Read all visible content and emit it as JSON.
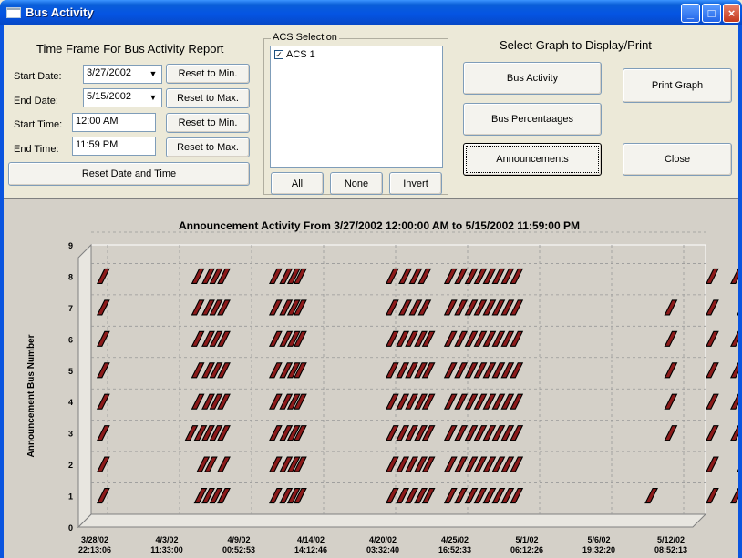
{
  "window": {
    "title": "Bus Activity",
    "controls": [
      "_",
      "□",
      "×"
    ]
  },
  "timeframe": {
    "heading": "Time Frame For Bus Activity Report",
    "start_date_label": "Start Date:",
    "start_date_value": "3/27/2002",
    "end_date_label": "End Date:",
    "end_date_value": "5/15/2002",
    "start_time_label": "Start Time:",
    "start_time_value": "12:00 AM",
    "end_time_label": "End Time:",
    "end_time_value": "11:59 PM",
    "reset_min_1": "Reset to Min.",
    "reset_max_1": "Reset to  Max.",
    "reset_min_2": "Reset to Min.",
    "reset_max_2": "Reset to  Max.",
    "reset_all": "Reset Date and Time"
  },
  "acs": {
    "title": "ACS Selection",
    "items": [
      {
        "label": "ACS 1",
        "checked": true
      }
    ],
    "all_label": "All",
    "none_label": "None",
    "invert_label": "Invert"
  },
  "graph_select": {
    "heading": "Select Graph to Display/Print",
    "bus_activity": "Bus Activity",
    "print_graph": "Print Graph",
    "bus_percentages": "Bus Percentaages",
    "announcements": "Announcements",
    "close": "Close"
  },
  "chart_data": {
    "type": "scatter",
    "title": "Announcement Activity From 3/27/2002 12:00:00 AM to 5/15/2002 11:59:00 PM",
    "ylabel": "Announcement Bus Number",
    "xlabel": "",
    "ylim": [
      0,
      9
    ],
    "y_ticks": [
      "0",
      "1",
      "2",
      "3",
      "4",
      "5",
      "6",
      "7",
      "8",
      "9"
    ],
    "x_tick_labels": [
      {
        "date": "3/28/02",
        "time": "22:13:06"
      },
      {
        "date": "4/3/02",
        "time": "11:33:00"
      },
      {
        "date": "4/9/02",
        "time": "00:52:53"
      },
      {
        "date": "4/14/02",
        "time": "14:12:46"
      },
      {
        "date": "4/20/02",
        "time": "03:32:40"
      },
      {
        "date": "4/25/02",
        "time": "16:52:33"
      },
      {
        "date": "5/1/02",
        "time": "06:12:26"
      },
      {
        "date": "5/6/02",
        "time": "19:32:20"
      },
      {
        "date": "5/12/02",
        "time": "08:52:13"
      }
    ],
    "grid": true,
    "bar_color": "#8b1a1a",
    "series": [
      {
        "bus": 8,
        "days": [
          0.2,
          7.5,
          8.3,
          8.9,
          9.5,
          13.5,
          14.3,
          14.9,
          15.4,
          22.5,
          23.5,
          24.3,
          25.0,
          27.0,
          27.8,
          28.6,
          29.3,
          30.0,
          30.7,
          31.4,
          32.1,
          47.2,
          49.1,
          49.8,
          50.4
        ]
      },
      {
        "bus": 7,
        "days": [
          0.2,
          7.5,
          8.3,
          8.9,
          9.5,
          13.5,
          14.3,
          14.9,
          15.4,
          22.5,
          23.5,
          24.3,
          25.0,
          27.0,
          27.8,
          28.6,
          29.3,
          30.0,
          30.7,
          31.4,
          32.1,
          44.0,
          47.2,
          49.6,
          50.4
        ]
      },
      {
        "bus": 6,
        "days": [
          0.2,
          7.5,
          8.3,
          8.9,
          9.5,
          13.5,
          14.3,
          14.9,
          15.4,
          22.5,
          23.3,
          24.0,
          24.7,
          25.3,
          27.0,
          27.8,
          28.6,
          29.3,
          30.0,
          30.7,
          31.4,
          32.1,
          44.0,
          47.2,
          49.1,
          49.8,
          50.4
        ]
      },
      {
        "bus": 5,
        "days": [
          0.2,
          7.5,
          8.3,
          8.9,
          9.5,
          13.5,
          14.3,
          14.9,
          15.4,
          22.5,
          23.3,
          24.0,
          24.7,
          25.3,
          27.0,
          27.8,
          28.6,
          29.3,
          30.0,
          30.7,
          31.4,
          32.1,
          44.0,
          47.2,
          49.1,
          49.8,
          50.4
        ]
      },
      {
        "bus": 4,
        "days": [
          0.2,
          7.5,
          8.3,
          8.9,
          9.5,
          13.5,
          14.3,
          14.9,
          15.4,
          22.5,
          23.3,
          24.0,
          24.7,
          25.3,
          27.0,
          27.8,
          28.6,
          29.3,
          30.0,
          30.7,
          31.4,
          32.1,
          44.0,
          47.2,
          49.1,
          49.8,
          50.4
        ]
      },
      {
        "bus": 3,
        "days": [
          0.2,
          7.0,
          7.7,
          8.3,
          8.9,
          9.5,
          13.5,
          14.3,
          14.9,
          15.4,
          22.5,
          23.3,
          24.0,
          24.7,
          25.3,
          27.0,
          27.8,
          28.6,
          29.3,
          30.0,
          30.7,
          31.4,
          32.1,
          44.0,
          47.2,
          49.1,
          49.8,
          50.4
        ]
      },
      {
        "bus": 2,
        "days": [
          0.2,
          7.9,
          8.5,
          9.5,
          13.5,
          14.3,
          14.9,
          15.4,
          22.5,
          23.3,
          24.0,
          24.7,
          25.3,
          27.0,
          27.8,
          28.6,
          29.3,
          30.0,
          30.7,
          31.4,
          32.1,
          47.2,
          49.6,
          50.4
        ]
      },
      {
        "bus": 1,
        "days": [
          0.2,
          7.7,
          8.3,
          8.9,
          9.5,
          13.5,
          14.3,
          14.9,
          15.4,
          22.5,
          23.3,
          24.0,
          24.7,
          25.3,
          27.0,
          27.8,
          28.6,
          29.3,
          30.0,
          30.7,
          31.4,
          32.1,
          42.5,
          47.2,
          49.1,
          49.8,
          50.4
        ]
      }
    ]
  }
}
